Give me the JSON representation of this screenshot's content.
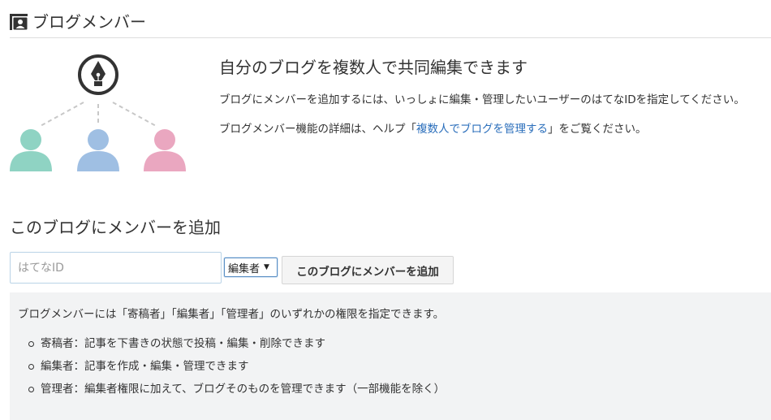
{
  "header": {
    "title": "ブログメンバー",
    "icon": "member-card-icon"
  },
  "illustration": {
    "pen_icon": "pen-nib-icon",
    "people": [
      {
        "icon": "person-icon",
        "color": "#8fd3c3"
      },
      {
        "icon": "person-icon",
        "color": "#9fbfe3"
      },
      {
        "icon": "person-icon",
        "color": "#eaa7c0"
      }
    ]
  },
  "intro": {
    "title": "自分のブログを複数人で共同編集できます",
    "description": "ブログにメンバーを追加するには、いっしょに編集・管理したいユーザーのはてなIDを指定してください。",
    "help_prefix": "ブログメンバー機能の詳細は、ヘルプ「",
    "help_link": "複数人でブログを管理する",
    "help_suffix": "」をご覧ください。"
  },
  "add_member": {
    "title": "このブログにメンバーを追加",
    "id_placeholder": "はてなID",
    "id_value": "",
    "role_selected": "編集者",
    "button_label": "このブログにメンバーを追加"
  },
  "info": {
    "intro": "ブログメンバーには「寄稿者」「編集者」「管理者」のいずれかの権限を指定できます。",
    "roles": [
      "寄稿者：記事を下書きの状態で投稿・編集・削除できます",
      "編集者：記事を作成・編集・管理できます",
      "管理者：編集者権限に加えて、ブログそのものを管理できます（一部機能を除く）"
    ]
  },
  "colors": {
    "link": "#2a6ebb",
    "info_background": "#f2f3f4",
    "input_border": "#b9d3e6"
  }
}
